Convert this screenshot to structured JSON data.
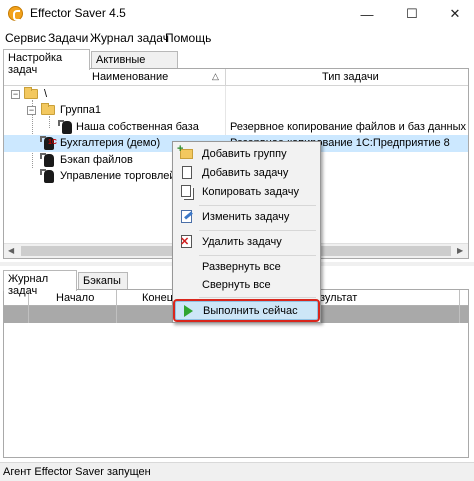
{
  "window": {
    "title": "Effector Saver 4.5",
    "controls": [
      "—",
      "☐",
      "✕"
    ]
  },
  "menu": [
    "Сервис",
    "Задачи",
    "Журнал задач",
    "Помощь"
  ],
  "top_tabs": [
    {
      "label": "Настройка задач",
      "active": true
    },
    {
      "label": "Активные задачи",
      "active": false
    }
  ],
  "task_grid": {
    "columns": [
      "Наименование",
      "Тип задачи"
    ],
    "rows": [
      {
        "name": "\\",
        "type": ""
      },
      {
        "name": "Группа1",
        "type": ""
      },
      {
        "name": "Наша собственная база",
        "type": "Резервное копирование файлов и баз данных"
      },
      {
        "name": "Бухгалтерия (демо)",
        "type": "Резервное копирование 1С:Предприятие 8"
      },
      {
        "name": "Бэкап файлов",
        "type": ""
      },
      {
        "name": "Управление торговлей",
        "type": ""
      }
    ],
    "badge_1c": "1С"
  },
  "bottom_tabs": [
    {
      "label": "Журнал задач",
      "active": true
    },
    {
      "label": "Бэкапы",
      "active": false
    }
  ],
  "log_grid": {
    "columns": [
      "Начало",
      "Конец",
      "зультат"
    ]
  },
  "context_menu": {
    "items": [
      {
        "label": "Добавить группу",
        "icon": "folder-add-icon"
      },
      {
        "label": "Добавить задачу",
        "icon": "task-add-icon"
      },
      {
        "label": "Копировать задачу",
        "icon": "copy-icon"
      },
      {
        "label": "Изменить задачу",
        "icon": "edit-icon"
      },
      {
        "label": "Удалить задачу",
        "icon": "delete-icon"
      },
      {
        "label": "Развернуть все",
        "icon": ""
      },
      {
        "label": "Свернуть все",
        "icon": ""
      },
      {
        "label": "Выполнить сейчас",
        "icon": "play-icon"
      }
    ],
    "highlight_color": "#d9261c"
  },
  "status": "Агент Effector Saver запущен",
  "colors": {
    "selected_row": "#cce8ff",
    "accent_icon": "#f2a21c",
    "run_icon": "#2fa52f"
  }
}
